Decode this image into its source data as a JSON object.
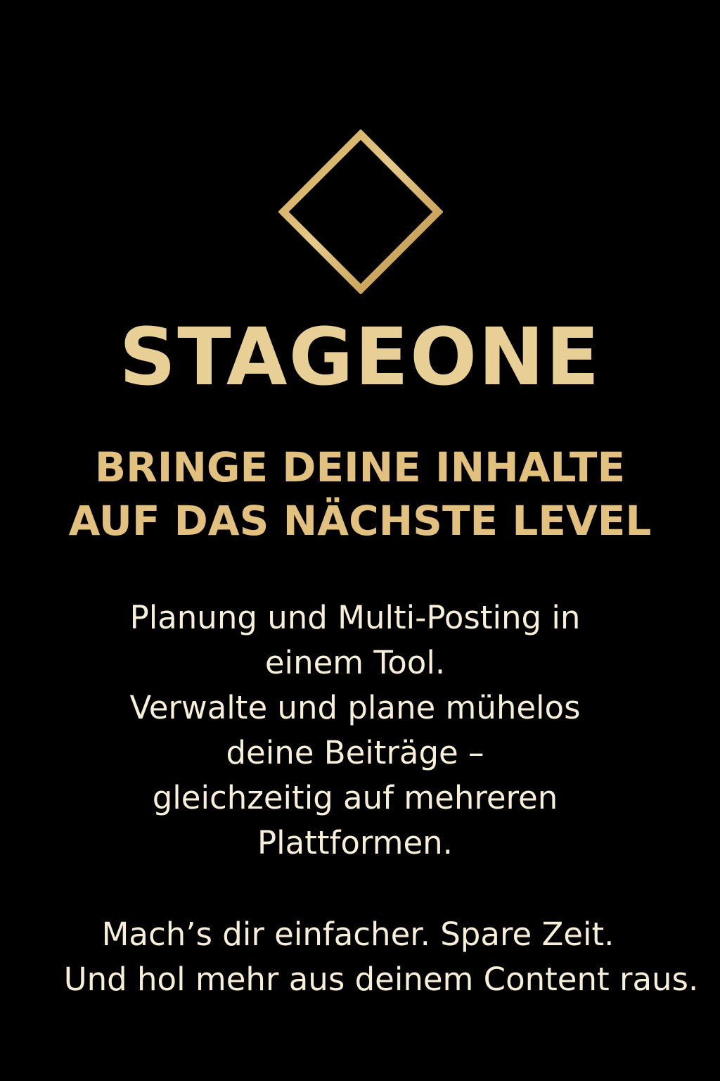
{
  "colors": {
    "background": "#000000",
    "gold_light": "#e8cf96",
    "gold": "#e2c17f",
    "body_text": "#f7efd9"
  },
  "logo": {
    "icon": "diamond-split-icon"
  },
  "brand": {
    "name": "STAGEONE"
  },
  "headline": {
    "lines": [
      "BRINGE DEINE INHALTE",
      "AUF DAS NÄCHSTE LEVEL"
    ]
  },
  "body": {
    "lines": [
      "Planung und Multi-Posting in",
      "einem Tool.",
      "Verwalte und plane mühelos",
      "deine Beiträge –",
      "gleichzeitig auf mehreren",
      "Plattformen."
    ]
  },
  "closing": {
    "lines": [
      "Mach’s dir einfacher. Spare Zeit.",
      "Und hol mehr aus deinem Content raus."
    ]
  }
}
